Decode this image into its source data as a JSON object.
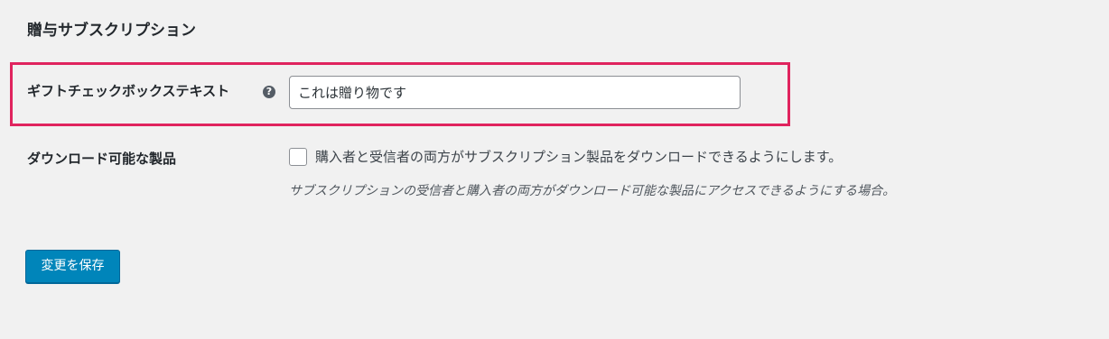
{
  "section": {
    "title": "贈与サブスクリプション"
  },
  "gift_checkbox_text": {
    "label": "ギフトチェックボックステキスト",
    "help_icon": "question-circle-icon",
    "help_glyph": "?",
    "value": "これは贈り物です"
  },
  "downloadable": {
    "label": "ダウンロード可能な製品",
    "checkbox_checked": false,
    "checkbox_label": "購入者と受信者の両方がサブスクリプション製品をダウンロードできるようにします。",
    "description": "サブスクリプションの受信者と購入者の両方がダウンロード可能な製品にアクセスできるようにする場合。"
  },
  "actions": {
    "save_label": "変更を保存"
  },
  "colors": {
    "highlight_border": "#e0245e",
    "button_primary": "#0085ba",
    "background": "#f1f1f1"
  }
}
